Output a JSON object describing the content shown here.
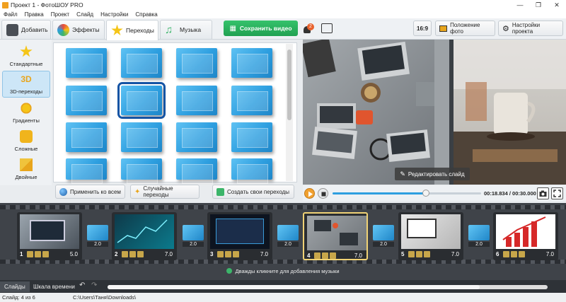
{
  "window": {
    "title": "Проект 1 - ФотоШОУ PRO",
    "minimize": "—",
    "maximize": "❐",
    "close": "✕"
  },
  "menu": [
    "Файл",
    "Правка",
    "Проект",
    "Слайд",
    "Настройки",
    "Справка"
  ],
  "tabs": [
    {
      "label": "Добавить",
      "icon": "folder-icon"
    },
    {
      "label": "Эффекты",
      "icon": "palette-icon"
    },
    {
      "label": "Переходы",
      "icon": "star-icon",
      "active": true
    },
    {
      "label": "Музыка",
      "icon": "music-note-icon"
    }
  ],
  "toolbar": {
    "save_video": "Сохранить видео",
    "notifications_count": "2",
    "aspect_ratio": "16:9",
    "photo_position": "Положение фото",
    "project_settings": "Настройки проекта"
  },
  "categories": [
    {
      "label": "Стандартные",
      "icon": "star-icon",
      "color": "#f5c518"
    },
    {
      "label": "3D-переходы",
      "icon": "3d-icon",
      "color": "#e8a51c",
      "active": true
    },
    {
      "label": "Градиенты",
      "icon": "sun-icon",
      "color": "#f0c020"
    },
    {
      "label": "Сложные",
      "icon": "puzzle-icon",
      "color": "#f0b41c"
    },
    {
      "label": "Двойные",
      "icon": "double-tile-icon",
      "color": "#f0c33c"
    }
  ],
  "grid_actions": {
    "apply_all": "Применить ко всем",
    "random": "Случайные переходы",
    "create": "Создать свои переходы"
  },
  "preview": {
    "edit_slide": "Редактировать слайд"
  },
  "playback": {
    "time": "00:18.834 / 00:30.000",
    "progress": 0.628
  },
  "slides": [
    {
      "num": "1",
      "duration": "5.0",
      "transition": "2.0"
    },
    {
      "num": "2",
      "duration": "7.0",
      "transition": "2.0"
    },
    {
      "num": "3",
      "duration": "7.0",
      "transition": "2.0"
    },
    {
      "num": "4",
      "duration": "7.0",
      "transition": "2.0",
      "active": true
    },
    {
      "num": "5",
      "duration": "7.0",
      "transition": "2.0"
    },
    {
      "num": "6",
      "duration": "7.0"
    }
  ],
  "music_hint": "Дважды кликните для добавления музыки",
  "bottom_tabs": [
    "Слайды",
    "Шкала времени"
  ],
  "status": {
    "slide": "Слайд: 4 из 6",
    "path": "C:\\Users\\Таня\\Downloads\\"
  },
  "colors": {
    "accent": "#2e9fe0",
    "save_green": "#21a152",
    "strip_bg": "#3f4349",
    "selected_outline": "#1554a4",
    "active_slide": "#f0d275"
  }
}
